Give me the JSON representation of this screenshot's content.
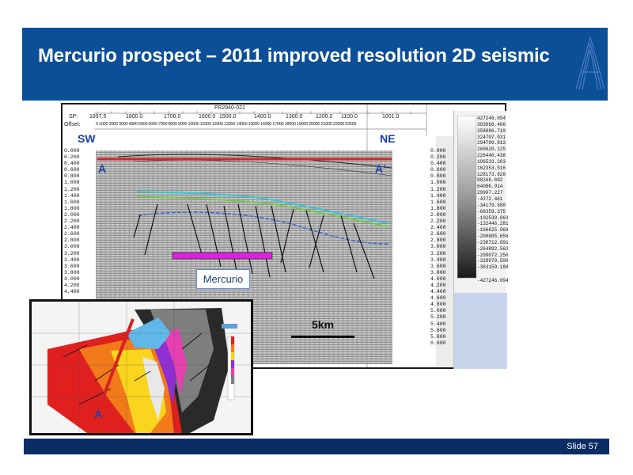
{
  "slide": {
    "title": "Mercurio prospect – 2011 improved resolution 2D seismic",
    "footer": "Slide 57"
  },
  "seismic": {
    "header_line": "FR2940-021",
    "sp_label": "SP:",
    "sp_values": [
      "1897.5",
      "1800.0",
      "1700.0",
      "1600.0",
      "1500.0",
      "1400.0",
      "1300.0",
      "1200.0",
      "1100.0",
      "1001.0"
    ],
    "offset_label": "Offset:",
    "offset_values": "0   1000 2000 3000 4000 5000 6000 7000 8000 9000 10000 11000 12000 13000 14000 15000 16000 17000 18000 19000 20000 21000 22000 22559",
    "direction_left": "SW",
    "direction_right": "NE",
    "section_start": "A",
    "section_end": "A'",
    "prospect_label": "Mercurio",
    "scale_label": "5km",
    "depth_left": [
      "0.000",
      "0.200",
      "0.400",
      "0.600",
      "0.800",
      "1.000",
      "1.200",
      "1.400",
      "1.600",
      "1.800",
      "2.000",
      "2.200",
      "2.400",
      "2.600",
      "2.800",
      "3.000",
      "3.200",
      "3.400",
      "3.600",
      "3.800",
      "4.000",
      "4.200",
      "4.400"
    ],
    "depth_right": [
      "0.000",
      "0.200",
      "0.400",
      "0.600",
      "0.800",
      "1.000",
      "1.200",
      "1.400",
      "1.600",
      "1.800",
      "2.000",
      "2.200",
      "2.400",
      "2.600",
      "2.800",
      "3.000",
      "3.200",
      "3.400",
      "3.600",
      "3.800",
      "4.000",
      "4.200",
      "4.400",
      "4.600",
      "4.800",
      "5.000",
      "5.200",
      "5.400",
      "5.600",
      "5.800",
      "6.000"
    ],
    "amplitude_scale": [
      "427246.094",
      "393066.406",
      "358886.719",
      "324707.031",
      "294799.813",
      "260620.125",
      "226440.438",
      "196533.203",
      "162353.516",
      "128173.828",
      "98266.602",
      "64086.914",
      "29907.227",
      "-4272.461",
      "-34179.688",
      "-68359.375",
      "-102539.063",
      "-132446.281",
      "-166625.969",
      "-200805.656",
      "-230712.891",
      "-264892.563",
      "-299072.250",
      "-328979.500",
      "-363159.188",
      "-427246.094"
    ],
    "map_marker": "A"
  },
  "colors": {
    "title_bar": "#0b4f98",
    "footer_bar": "#0b2d66",
    "accent_red": "#d62222",
    "magenta": "#e020e0",
    "label_blue": "#1e3fa6"
  }
}
